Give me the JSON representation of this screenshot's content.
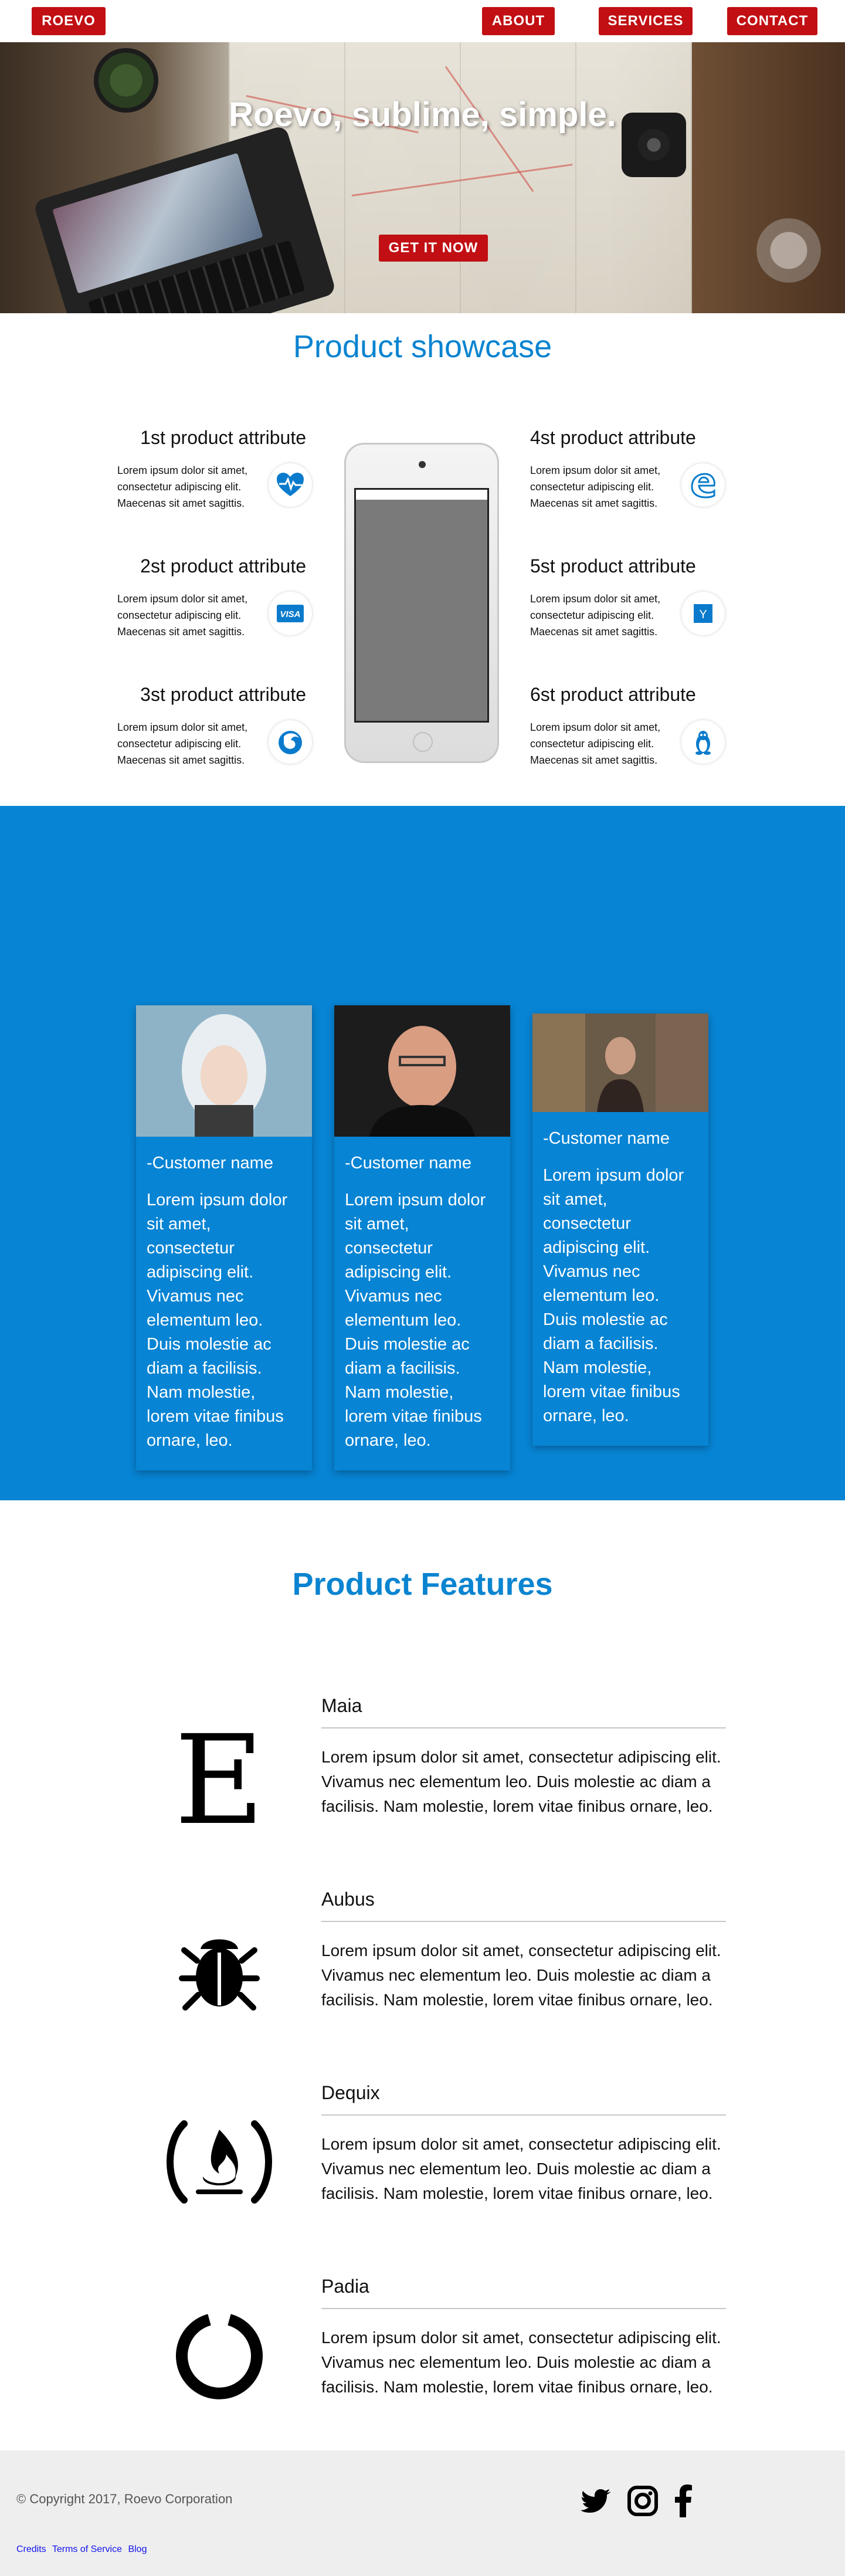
{
  "nav": {
    "logo": "ROEVO",
    "links": [
      "ABOUT",
      "SERVICES",
      "CONTACT"
    ]
  },
  "hero": {
    "title": "Roevo, sublime, simple.",
    "cta": "GET IT NOW"
  },
  "showcase": {
    "title": "Product showcase",
    "attributes": [
      {
        "title": "1st product attribute",
        "text": "Lorem ipsum dolor sit amet, consectetur adipiscing elit. Maecenas sit amet sagittis.",
        "icon": "heartbeat-icon"
      },
      {
        "title": "2st product attribute",
        "text": "Lorem ipsum dolor sit amet, consectetur adipiscing elit. Maecenas sit amet sagittis.",
        "icon": "visa-icon"
      },
      {
        "title": "3st product attribute",
        "text": "Lorem ipsum dolor sit amet, consectetur adipiscing elit. Maecenas sit amet sagittis.",
        "icon": "firefox-icon"
      },
      {
        "title": "4st product attribute",
        "text": "Lorem ipsum dolor sit amet, consectetur adipiscing elit. Maecenas sit amet sagittis.",
        "icon": "edge-icon"
      },
      {
        "title": "5st product attribute",
        "text": "Lorem ipsum dolor sit amet, consectetur adipiscing elit. Maecenas sit amet sagittis.",
        "icon": "hacker-news-icon"
      },
      {
        "title": "6st product attribute",
        "text": "Lorem ipsum dolor sit amet, consectetur adipiscing elit. Maecenas sit amet sagittis.",
        "icon": "linux-icon"
      }
    ]
  },
  "testimonials": [
    {
      "name": "-Customer name",
      "text": "Lorem ipsum dolor sit amet, consectetur adipiscing elit. Vivamus nec elementum leo. Duis molestie ac diam a facilisis. Nam molestie, lorem vitae finibus ornare, leo."
    },
    {
      "name": "-Customer name",
      "text": "Lorem ipsum dolor sit amet, consectetur adipiscing elit. Vivamus nec elementum leo. Duis molestie ac diam a facilisis. Nam molestie, lorem vitae finibus ornare, leo."
    },
    {
      "name": "-Customer name",
      "text": "Lorem ipsum dolor sit amet, consectetur adipiscing elit. Vivamus nec elementum leo. Duis molestie ac diam a facilisis. Nam molestie, lorem vitae finibus ornare, leo."
    }
  ],
  "features": {
    "title": "Product Features",
    "items": [
      {
        "name": "Maia",
        "text": "Lorem ipsum dolor sit amet, consectetur adipiscing elit. Vivamus nec elementum leo. Duis molestie ac diam a facilisis. Nam molestie, lorem vitae finibus ornare, leo.",
        "icon": "etsy-icon",
        "glyph": "E"
      },
      {
        "name": "Aubus",
        "text": "Lorem ipsum dolor sit amet, consectetur adipiscing elit. Vivamus nec elementum leo. Duis molestie ac diam a facilisis. Nam molestie, lorem vitae finibus ornare, leo.",
        "icon": "bug-icon"
      },
      {
        "name": "Dequix",
        "text": "Lorem ipsum dolor sit amet, consectetur adipiscing elit. Vivamus nec elementum leo. Duis molestie ac diam a facilisis. Nam molestie, lorem vitae finibus ornare, leo.",
        "icon": "freecodecamp-icon"
      },
      {
        "name": "Padia",
        "text": "Lorem ipsum dolor sit amet, consectetur adipiscing elit. Vivamus nec elementum leo. Duis molestie ac diam a facilisis. Nam molestie, lorem vitae finibus ornare, leo.",
        "icon": "circle-notch-icon"
      }
    ]
  },
  "footer": {
    "copyright": "© Copyright 2017, Roevo Corporation",
    "links": [
      "Credits",
      "Terms of Service",
      "Blog"
    ],
    "social": [
      "twitter-icon",
      "instagram-icon",
      "facebook-icon"
    ]
  },
  "colors": {
    "accent_red": "#c10f13",
    "brand_blue": "#0784d4",
    "title_blue": "#0a84d0",
    "footer_bg": "#eeeeee",
    "link_blue": "#1313ee"
  }
}
